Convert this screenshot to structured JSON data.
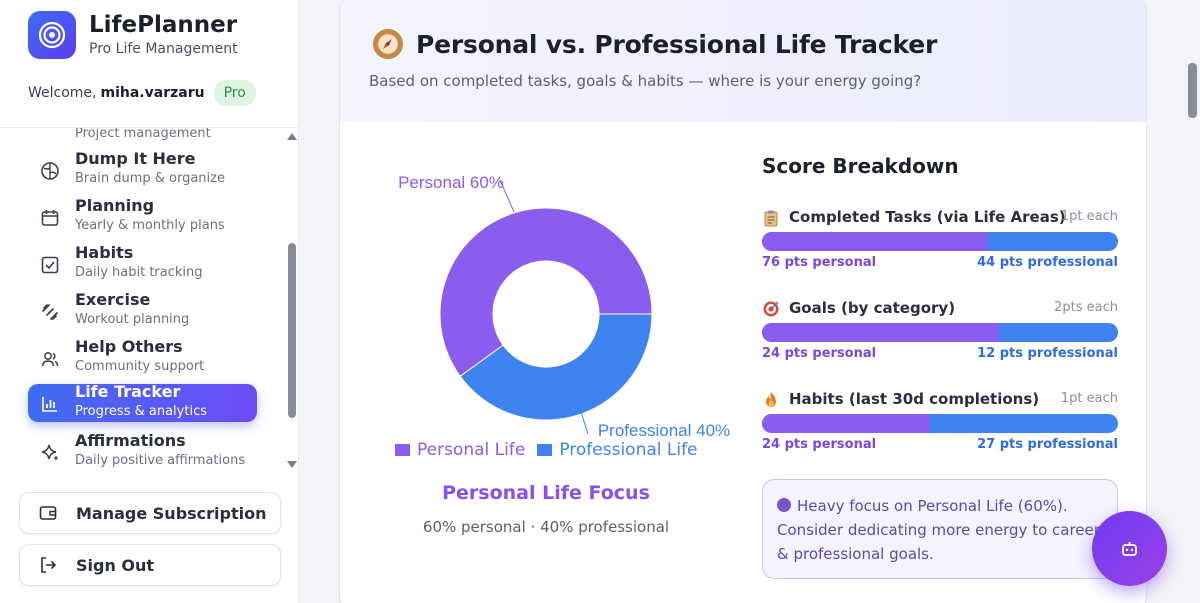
{
  "app": {
    "name": "LifePlanner",
    "tagline": "Pro Life Management",
    "welcome_prefix": "Welcome,",
    "username": "miha.varzaru",
    "plan_badge": "Pro"
  },
  "sidebar": {
    "items": [
      {
        "label": "",
        "sub": "Project management",
        "icon": "folder-icon"
      },
      {
        "label": "Dump It Here",
        "sub": "Brain dump & organize",
        "icon": "brain-icon"
      },
      {
        "label": "Planning",
        "sub": "Yearly & monthly plans",
        "icon": "calendar-icon"
      },
      {
        "label": "Habits",
        "sub": "Daily habit tracking",
        "icon": "checkbox-icon"
      },
      {
        "label": "Exercise",
        "sub": "Workout planning",
        "icon": "dumbbell-icon"
      },
      {
        "label": "Help Others",
        "sub": "Community support",
        "icon": "people-icon"
      },
      {
        "label": "Life Tracker",
        "sub": "Progress & analytics",
        "icon": "bar-chart-icon",
        "active": true
      },
      {
        "label": "Affirmations",
        "sub": "Daily positive affirmations",
        "icon": "sparkle-icon"
      }
    ],
    "manage_subscription": "Manage Subscription",
    "sign_out": "Sign Out"
  },
  "tracker": {
    "title": "Personal vs. Professional Life Tracker",
    "subtitle": "Based on completed tasks, goals & habits — where is your energy going?",
    "focus_title": "Personal Life Focus",
    "focus_sub": "60% personal · 40% professional",
    "breakdown_title": "Score Breakdown",
    "metrics": [
      {
        "emoji": "clipboard-icon",
        "label": "Completed Tasks (via Life Areas)",
        "unit": "1pt each",
        "personal": 76,
        "professional": 44,
        "personal_text": "76 pts personal",
        "professional_text": "44 pts professional"
      },
      {
        "emoji": "target-icon",
        "label": "Goals (by category)",
        "unit": "2pts each",
        "personal": 24,
        "professional": 12,
        "personal_text": "24 pts personal",
        "professional_text": "12 pts professional"
      },
      {
        "emoji": "fire-icon",
        "label": "Habits (last 30d completions)",
        "unit": "1pt each",
        "personal": 24,
        "professional": 27,
        "personal_text": "24 pts personal",
        "professional_text": "27 pts professional"
      }
    ],
    "insight": "Heavy focus on Personal Life (60%). Consider dedicating more energy to career & professional goals."
  },
  "chart_data": {
    "type": "pie",
    "categories": [
      "Personal Life",
      "Professional Life"
    ],
    "values": [
      60,
      40
    ],
    "data_labels": [
      "Personal 60%",
      "Professional 40%"
    ],
    "legend": [
      "Personal Life",
      "Professional Life"
    ],
    "colors": [
      "#8b5cf0",
      "#3f83f0"
    ],
    "legend_position": "bottom"
  },
  "colors": {
    "personal": "#8b5cf0",
    "professional": "#3f83f0",
    "accent": "#5b3cf0"
  }
}
